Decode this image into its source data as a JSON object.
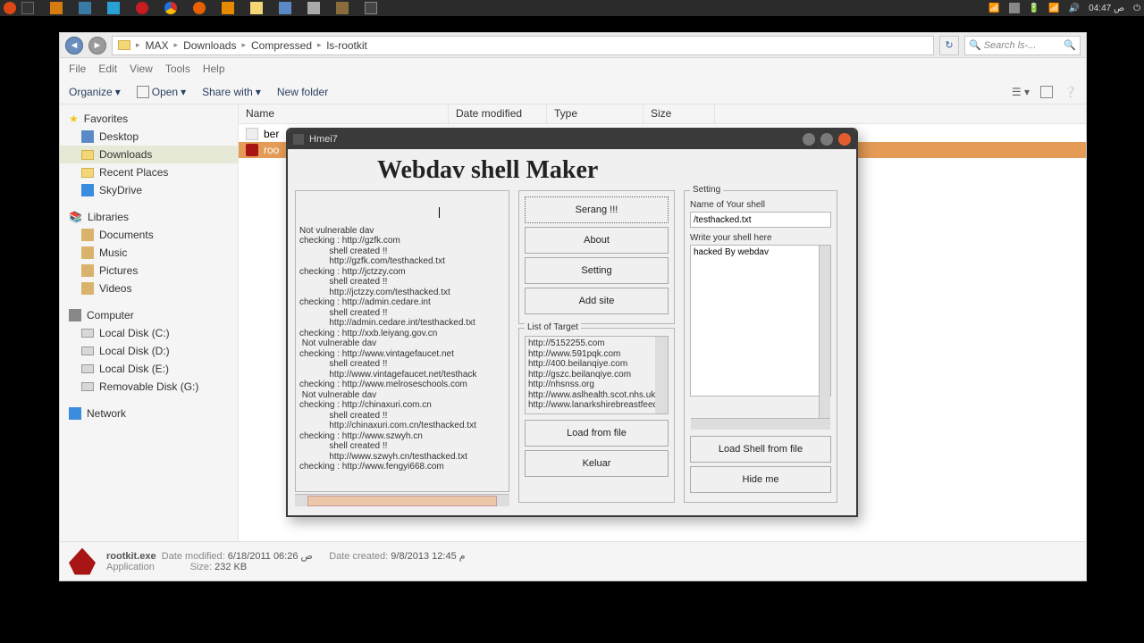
{
  "panel": {
    "clock": "04:47",
    "clock_suffix": "ص"
  },
  "explorer": {
    "breadcrumb": [
      "MAX",
      "Downloads",
      "Compressed",
      "ls-rootkit"
    ],
    "search_placeholder": "Search ls-...",
    "menus": [
      "File",
      "Edit",
      "View",
      "Tools",
      "Help"
    ],
    "toolbar": {
      "organize": "Organize",
      "open": "Open",
      "share": "Share with",
      "newfolder": "New folder"
    },
    "columns": [
      "Name",
      "Date modified",
      "Type",
      "Size"
    ],
    "sidebar": {
      "favorites": "Favorites",
      "fav_items": [
        "Desktop",
        "Downloads",
        "Recent Places",
        "SkyDrive"
      ],
      "libraries": "Libraries",
      "lib_items": [
        "Documents",
        "Music",
        "Pictures",
        "Videos"
      ],
      "computer": "Computer",
      "comp_items": [
        "Local Disk (C:)",
        "Local Disk (D:)",
        "Local Disk (E:)",
        "Removable Disk (G:)"
      ],
      "network": "Network"
    },
    "files": [
      {
        "name": "ber",
        "sel": false
      },
      {
        "name": "roo",
        "sel": true
      }
    ],
    "status": {
      "filename": "rootkit.exe",
      "modified_lbl": "Date modified:",
      "modified": "6/18/2011 06:26 ص",
      "created_lbl": "Date created:",
      "created": "9/8/2013 12:45 م",
      "size_lbl": "Size:",
      "size": "232 KB",
      "type": "Application"
    }
  },
  "tool": {
    "title": "Hmei7",
    "heading": "Webdav shell Maker",
    "buttons": {
      "serang": "Serang !!!",
      "about": "About",
      "setting": "Setting",
      "addsite": "Add site",
      "loadfile": "Load from file",
      "keluar": "Keluar",
      "loadshell": "Load Shell from file",
      "hide": "Hide me"
    },
    "labels": {
      "targets": "List of Target",
      "setting": "Setting",
      "shellname": "Name of Your shell",
      "shellcontent": "Write your shell here"
    },
    "shell_name": "/testhacked.txt",
    "shell_body": "hacked By webdav",
    "targets": [
      "http://5152255.com",
      "http://www.591pqk.com",
      "http://400.beilanqiye.com",
      "http://gszc.beilanqiye.com",
      "http://nhsnss.org",
      "http://www.aslhealth.scot.nhs.uk",
      "http://www.lanarkshirebreastfeedin"
    ],
    "log": [
      "Not vulnerable dav",
      "checking : http://gzfk.com",
      "            shell created !!",
      "            http://gzfk.com/testhacked.txt",
      "checking : http://jctzzy.com",
      "            shell created !!",
      "            http://jctzzy.com/testhacked.txt",
      "checking : http://admin.cedare.int",
      "            shell created !!",
      "            http://admin.cedare.int/testhacked.txt",
      "checking : http://xxb.leiyang.gov.cn",
      " Not vulnerable dav",
      "checking : http://www.vintagefaucet.net",
      "            shell created !!",
      "            http://www.vintagefaucet.net/testhack",
      "checking : http://www.melroseschools.com",
      " Not vulnerable dav",
      "checking : http://chinaxuri.com.cn",
      "            shell created !!",
      "            http://chinaxuri.com.cn/testhacked.txt",
      "checking : http://www.szwyh.cn",
      "            shell created !!",
      "            http://www.szwyh.cn/testhacked.txt",
      "checking : http://www.fengyi668.com"
    ]
  }
}
